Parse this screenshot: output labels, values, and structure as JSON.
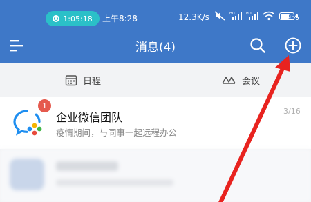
{
  "status_bar": {
    "call_time": "1:05:18",
    "clock": "上午8:28",
    "net_speed": "12.3K/s",
    "battery_percent": "69%",
    "battery_level": 0.69
  },
  "title_bar": {
    "title": "消息(4)"
  },
  "tabs": [
    {
      "label": "日程",
      "icon": "calendar-icon"
    },
    {
      "label": "会议",
      "icon": "meeting-icon"
    }
  ],
  "chat_list": [
    {
      "title": "企业微信团队",
      "preview": "疫情期间，与同事一起远程办公",
      "time": "3/16",
      "unread": "1"
    }
  ],
  "colors": {
    "header": "#3e78c8",
    "call_pill": "#2bc0c8",
    "badge": "#e55a4e",
    "annotation": "#e8231f"
  }
}
